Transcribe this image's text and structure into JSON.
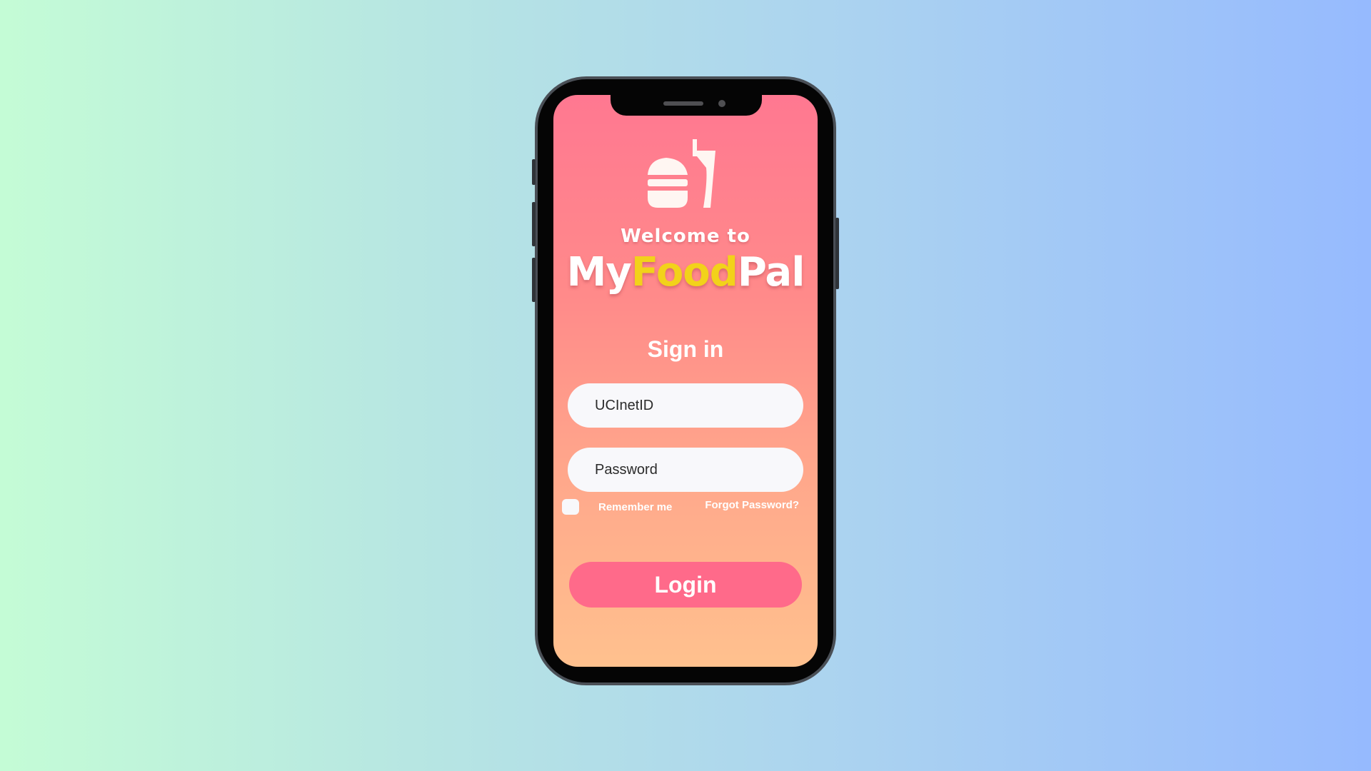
{
  "welcome": {
    "line1": "Welcome to",
    "brand_part1": "My",
    "brand_part2": "Food",
    "brand_part3": "Pal"
  },
  "signin": {
    "title": "Sign in",
    "username_placeholder": "UCInetID",
    "password_placeholder": "Password",
    "remember_label": "Remember me",
    "forgot_label": "Forgot Password?",
    "login_label": "Login"
  },
  "icons": {
    "logo": "burger-drink-icon"
  },
  "colors": {
    "accent_yellow": "#f2d21a",
    "login_button": "#ff6a8a",
    "screen_gradient_top": "#ff7891",
    "screen_gradient_bottom": "#ffc18e"
  }
}
